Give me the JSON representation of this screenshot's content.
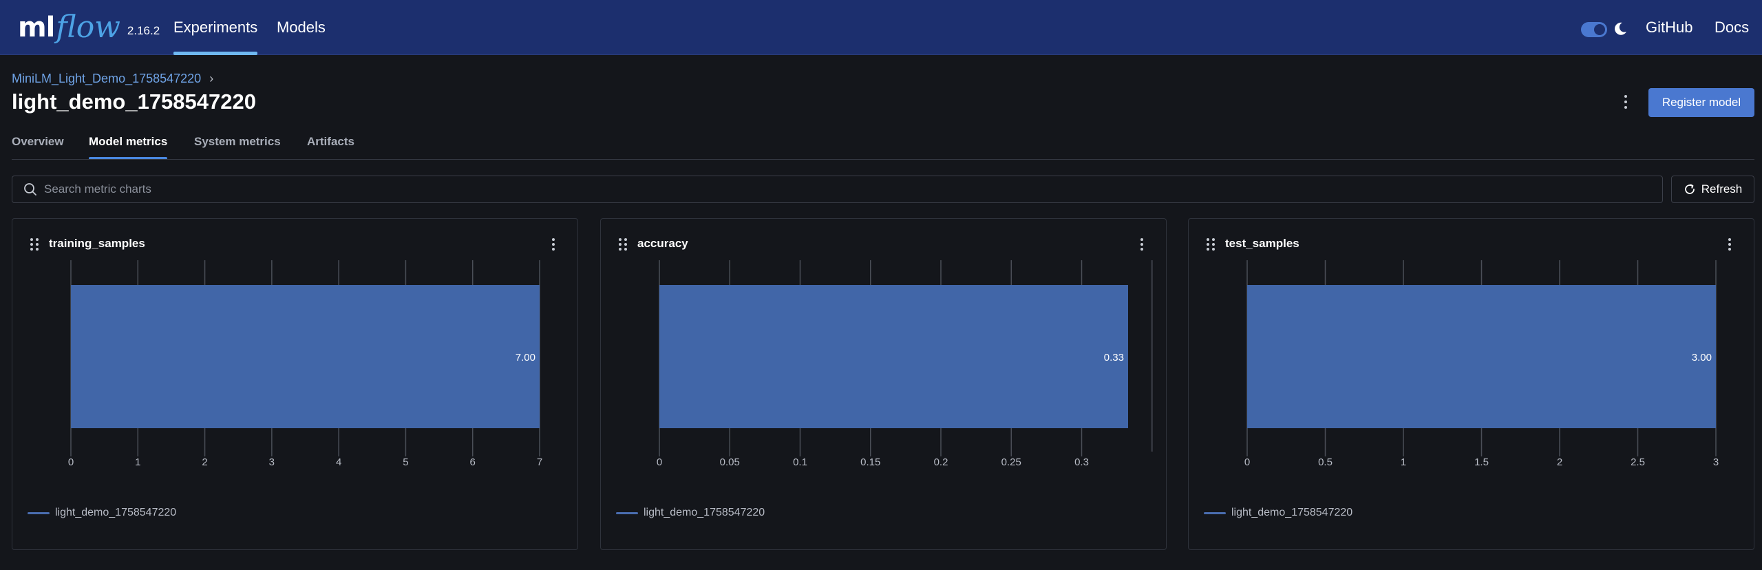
{
  "header": {
    "logo_ml": "ml",
    "logo_flow": "flow",
    "version": "2.16.2",
    "nav": [
      {
        "label": "Experiments",
        "active": true
      },
      {
        "label": "Models",
        "active": false
      }
    ],
    "github": "GitHub",
    "docs": "Docs"
  },
  "page": {
    "breadcrumb": "MiniLM_Light_Demo_1758547220",
    "title": "light_demo_1758547220",
    "register_label": "Register model"
  },
  "tabs": [
    {
      "label": "Overview",
      "active": false
    },
    {
      "label": "Model metrics",
      "active": true
    },
    {
      "label": "System metrics",
      "active": false
    },
    {
      "label": "Artifacts",
      "active": false
    }
  ],
  "search": {
    "placeholder": "Search metric charts"
  },
  "refresh_label": "Refresh",
  "colors": {
    "bar": "#4166a8",
    "accent": "#4a78d0"
  },
  "chart_data": [
    {
      "type": "bar",
      "orientation": "horizontal",
      "title": "training_samples",
      "categories": [
        "light_demo_1758547220"
      ],
      "values": [
        7
      ],
      "value_label": "7.00",
      "xlim": [
        0,
        7
      ],
      "ticks": [
        0,
        1,
        2,
        3,
        4,
        5,
        6,
        7
      ],
      "tick_labels": [
        "0",
        "1",
        "2",
        "3",
        "4",
        "5",
        "6",
        "7"
      ],
      "legend": "light_demo_1758547220",
      "grid": true
    },
    {
      "type": "bar",
      "orientation": "horizontal",
      "title": "accuracy",
      "categories": [
        "light_demo_1758547220"
      ],
      "values": [
        0.333
      ],
      "value_label": "0.33",
      "xlim": [
        0,
        0.35
      ],
      "ticks": [
        0,
        0.05,
        0.1,
        0.15,
        0.2,
        0.25,
        0.3
      ],
      "tick_labels": [
        "0",
        "0.05",
        "0.1",
        "0.15",
        "0.2",
        "0.25",
        "0.3"
      ],
      "legend": "light_demo_1758547220",
      "grid": true
    },
    {
      "type": "bar",
      "orientation": "horizontal",
      "title": "test_samples",
      "categories": [
        "light_demo_1758547220"
      ],
      "values": [
        3
      ],
      "value_label": "3.00",
      "xlim": [
        0,
        3
      ],
      "ticks": [
        0,
        0.5,
        1,
        1.5,
        2,
        2.5,
        3
      ],
      "tick_labels": [
        "0",
        "0.5",
        "1",
        "1.5",
        "2",
        "2.5",
        "3"
      ],
      "legend": "light_demo_1758547220",
      "grid": true
    }
  ]
}
